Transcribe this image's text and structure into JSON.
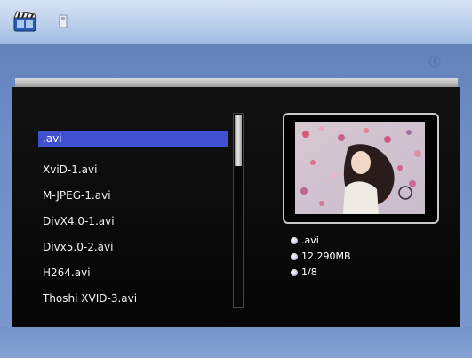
{
  "header": {
    "left_icon": "film-clapper-icon",
    "secondary_icon": "memory-card-icon",
    "right_icon": "info-icon"
  },
  "file_list": {
    "items": [
      ".avi",
      "XviD-1.avi",
      "M-JPEG-1.avi",
      "DivX4.0-1.avi",
      "Divx5.0-2.avi",
      "H264.avi",
      "Thoshi XVID-3.avi"
    ],
    "selected_index": 0
  },
  "scrollbar": {
    "position_fraction": 0.0
  },
  "preview": {
    "image_icon": "video-thumbnail"
  },
  "file_info": {
    "name": ".avi",
    "size": "12.290MB",
    "index": "1/8"
  },
  "colors": {
    "selection": "#3f4fd0",
    "panel": "#0a0a0a",
    "background": "#6f8ec6"
  }
}
